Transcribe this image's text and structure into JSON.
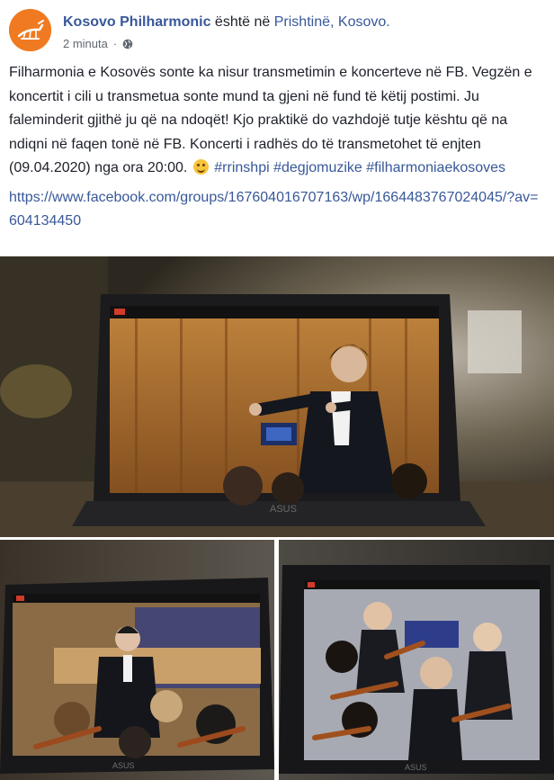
{
  "post": {
    "author_name": "Kosovo Philharmonic",
    "author_suffix": " është në ",
    "location": "Prishtinë, Kosovo.",
    "timestamp": "2 minuta",
    "audience_icon": "globe-icon",
    "avatar_icon": "philharmonic-logo",
    "text_body": "Filharmonia e Kosovës sonte ka nisur transmetimin e koncerteve në FB. Vegzën e koncertit i cili u transmetua sonte mund ta gjeni në fund të këtij postimi. Ju faleminderit gjithë ju që na ndoqët! Kjo praktikë do vazhdojë tutje kështu që na ndiqni në faqen tonë në FB. Koncerti i radhës do të transmetohet të enjten (09.04.2020) nga ora 20:00.",
    "emoji": "smiling-face-emoji",
    "hashtags": [
      "#rrinshpi",
      "#degjomuzike",
      "#filharmoniaekosoves"
    ],
    "link": "https://www.facebook.com/groups/167604016707163/wp/1664483767024045/?av=604134450"
  },
  "photos": {
    "main_brand": "ASUS",
    "left_brand": "ASUS",
    "right_brand": "ASUS"
  },
  "colors": {
    "link": "#385898",
    "text": "#1d2129",
    "meta": "#606770",
    "avatar_bg": "#f07a22"
  }
}
